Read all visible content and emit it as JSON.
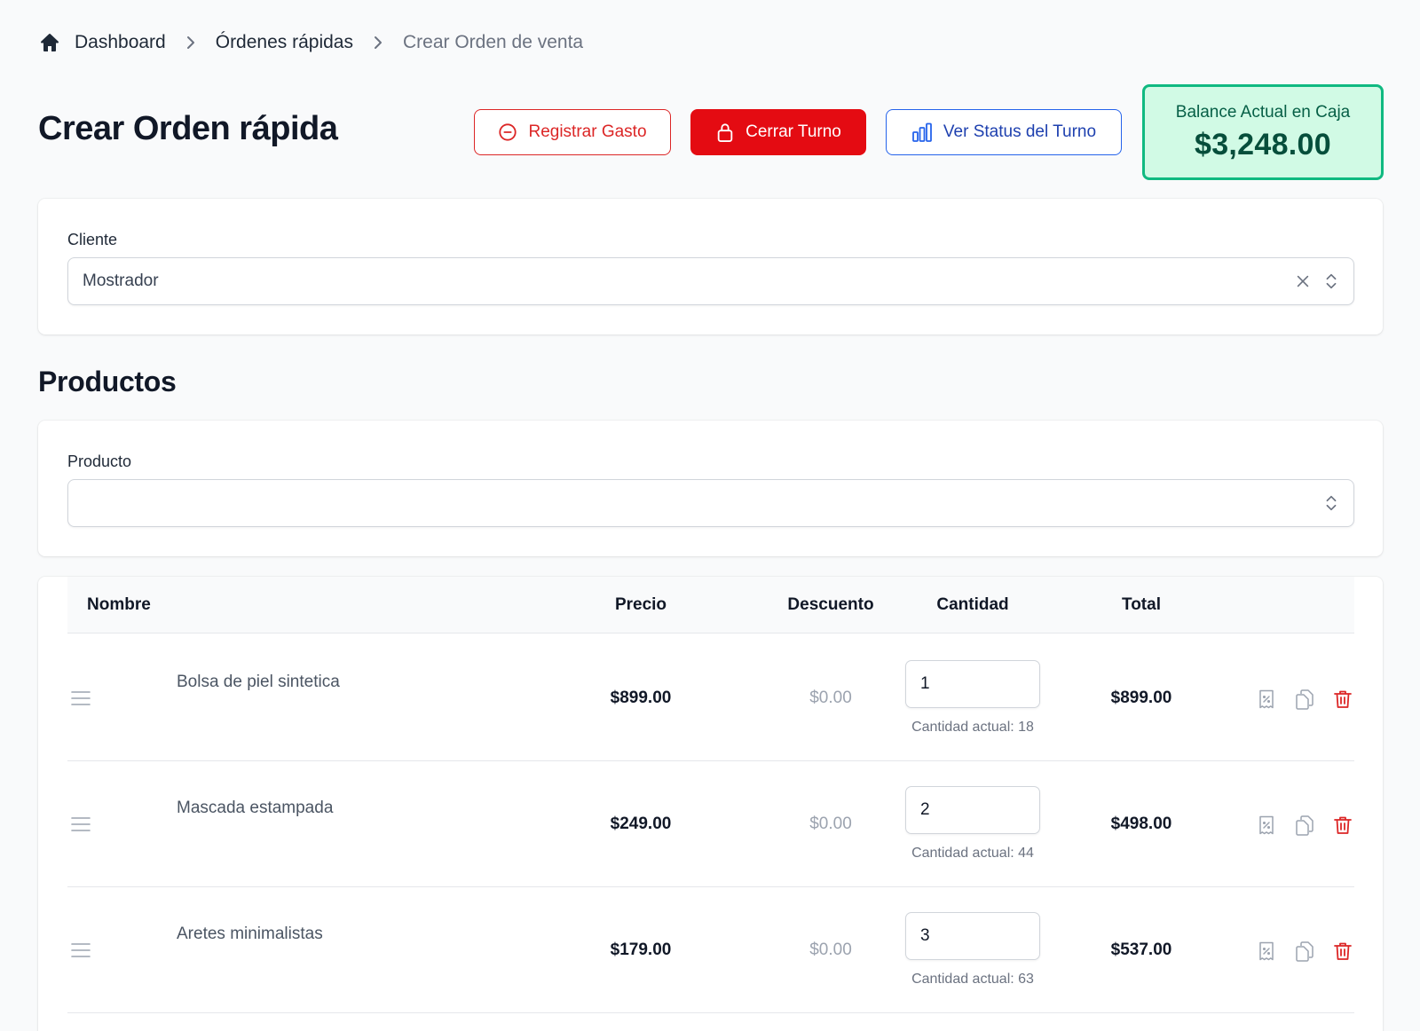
{
  "breadcrumb": {
    "items": [
      "Dashboard",
      "Órdenes rápidas",
      "Crear Orden de venta"
    ]
  },
  "header": {
    "title": "Crear Orden rápida",
    "register_expense_label": "Registrar Gasto",
    "close_shift_label": "Cerrar Turno",
    "shift_status_label": "Ver Status del Turno",
    "balance_label": "Balance Actual en Caja",
    "balance_value": "$3,248.00"
  },
  "cliente": {
    "label": "Cliente",
    "value": "Mostrador"
  },
  "productos": {
    "title": "Productos",
    "field_label": "Producto",
    "field_value": ""
  },
  "table": {
    "columns": [
      "Nombre",
      "Precio",
      "Descuento",
      "Cantidad",
      "Total"
    ],
    "rows": [
      {
        "name": "Bolsa de piel sintetica",
        "price": "$899.00",
        "discount": "$0.00",
        "qty": "1",
        "stock": "Cantidad actual: 18",
        "total": "$899.00"
      },
      {
        "name": "Mascada estampada",
        "price": "$249.00",
        "discount": "$0.00",
        "qty": "2",
        "stock": "Cantidad actual: 44",
        "total": "$498.00"
      },
      {
        "name": "Aretes minimalistas",
        "price": "$179.00",
        "discount": "$0.00",
        "qty": "3",
        "stock": "Cantidad actual: 63",
        "total": "$537.00"
      }
    ]
  },
  "icons": {
    "home": "home-icon",
    "separator": "chevron-right-icon",
    "expense": "minus-circle-icon",
    "close_shift": "lock-icon",
    "status": "bar-chart-icon",
    "clear": "close-icon",
    "select": "chevron-up-down-icon",
    "drag": "drag-handle-icon",
    "discount": "receipt-percent-icon",
    "duplicate": "duplicate-icon",
    "delete": "trash-icon"
  },
  "colors": {
    "danger": "#dc2626",
    "primary_red": "#e40b12",
    "blue": "#2563eb",
    "success_bg": "#d1fae5",
    "success_border": "#10b981"
  }
}
